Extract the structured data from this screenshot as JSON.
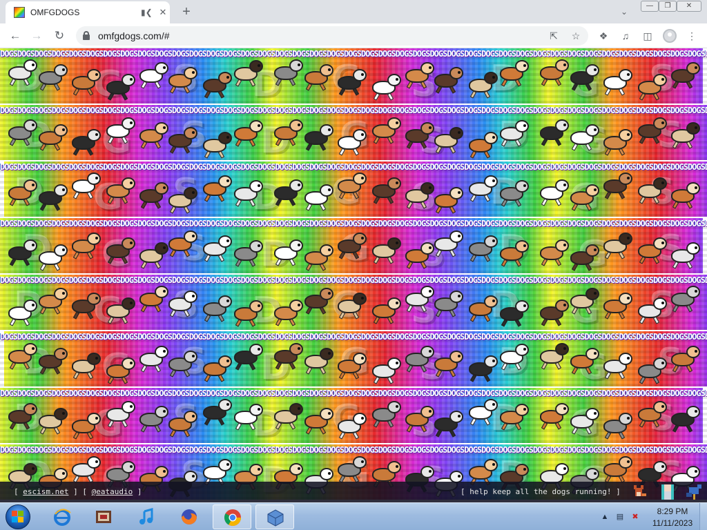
{
  "tab": {
    "title": "OMFGDOGS",
    "favicon": "omfgdogs-favicon-icon",
    "audio_icon": "speaker-icon"
  },
  "window": {
    "minimize": "minimize-icon",
    "restore": "restore-icon",
    "close": "close-icon"
  },
  "toolbar": {
    "url": "omfgdogs.com/#",
    "icons": [
      "back-arrow-icon",
      "forward-arrow-icon",
      "reload-icon",
      "lock-icon",
      "share-icon",
      "bookmark-star-icon",
      "extensions-puzzle-icon",
      "media-control-icon",
      "side-panel-icon",
      "profile-icon",
      "menu-kebab-icon"
    ]
  },
  "page": {
    "band_word": "DOGS",
    "big_letters": [
      "D",
      "G",
      "S",
      "D",
      "G",
      "S",
      "D",
      "G",
      "S"
    ],
    "band_count": 8
  },
  "footer": {
    "bracket_open": "[",
    "bracket_close": "]",
    "link1": "escism.net",
    "link2": "@eataudio",
    "tagline": "[ help keep all the dogs running! ]"
  },
  "taskbar": {
    "apps": [
      "start-orb-icon",
      "internet-explorer-icon",
      "media-center-icon",
      "itunes-icon",
      "firefox-icon",
      "chrome-icon",
      "virtualbox-icon"
    ],
    "time": "8:29 PM",
    "date": "11/11/2023"
  },
  "colors": {
    "tabbar": "#dee1e6",
    "footer": "#121222",
    "taskbar": "#9dbbe0"
  }
}
